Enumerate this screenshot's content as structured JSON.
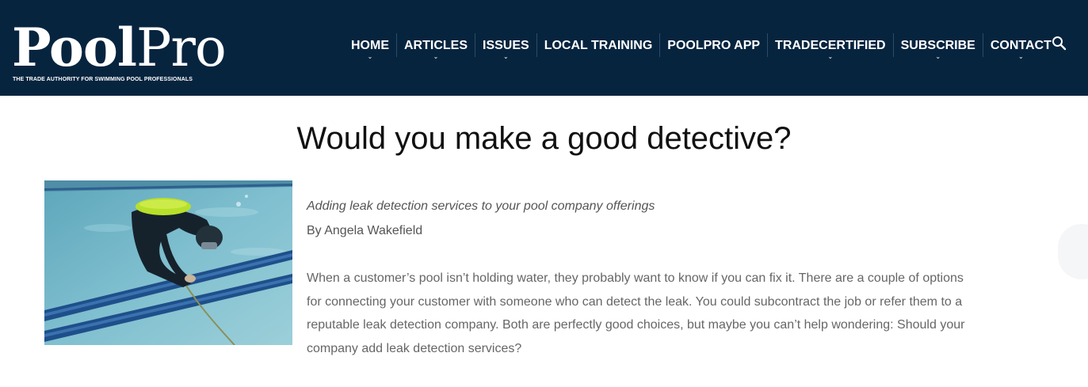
{
  "header": {
    "logo": {
      "pool": "Pool",
      "pro": "Pro",
      "tagline": "THE TRADE AUTHORITY FOR SWIMMING POOL PROFESSIONALS"
    },
    "nav": [
      {
        "label": "HOME",
        "has_dropdown": true
      },
      {
        "label": "ARTICLES",
        "has_dropdown": true
      },
      {
        "label": "ISSUES",
        "has_dropdown": true
      },
      {
        "label": "LOCAL TRAINING",
        "has_dropdown": false
      },
      {
        "label": "POOLPRO APP",
        "has_dropdown": false
      },
      {
        "label": "TRADECERTIFIED",
        "has_dropdown": true
      },
      {
        "label": "SUBSCRIBE",
        "has_dropdown": true
      },
      {
        "label": "CONTACT",
        "has_dropdown": true
      }
    ],
    "search_icon": "search-icon",
    "caret_icon": "chevron-down-icon"
  },
  "article": {
    "title": "Would you make a good detective?",
    "image": "scuba-diver-pool-leak-detection",
    "subtitle": "Adding leak detection services to your pool company offerings",
    "byline": "By Angela Wakefield",
    "body": "When a customer’s pool isn’t holding water, they probably want to know if you can fix it. There are a couple of options for connecting your customer with someone who can detect the leak. You could subcontract the job or refer them to a reputable leak detection company. Both are perfectly good choices, but maybe you can’t help wondering: Should your company add leak detection services?"
  },
  "colors": {
    "header_bg": "#07243f",
    "nav_text": "#ffffff",
    "title_text": "#111111",
    "body_text": "#666666",
    "pool_water": "#6fb3c6",
    "tile_stripe": "#1f4f8a",
    "diver_tank": "#b7e02a"
  }
}
